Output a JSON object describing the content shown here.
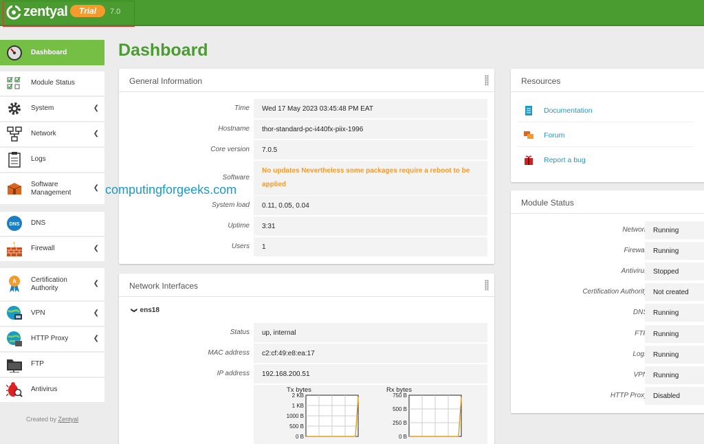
{
  "header": {
    "brand": "zentyal",
    "edition": "Trial",
    "version": "7.0"
  },
  "sidebar": {
    "items": [
      {
        "label": "Dashboard",
        "icon": "dashboard-gauge-icon",
        "active": true,
        "submenu": false
      },
      {
        "label": "Module Status",
        "icon": "checklist-icon",
        "submenu": false
      },
      {
        "label": "System",
        "icon": "gear-icon",
        "submenu": true
      },
      {
        "label": "Network",
        "icon": "network-icon",
        "submenu": true
      },
      {
        "label": "Logs",
        "icon": "clipboard-icon",
        "submenu": false
      },
      {
        "label": "Software\nManagement",
        "icon": "package-icon",
        "submenu": true
      },
      {
        "label": "DNS",
        "icon": "dns-icon",
        "submenu": false
      },
      {
        "label": "Firewall",
        "icon": "firewall-icon",
        "submenu": true
      },
      {
        "label": "Certification\nAuthority",
        "icon": "certificate-icon",
        "submenu": true
      },
      {
        "label": "VPN",
        "icon": "vpn-icon",
        "submenu": true
      },
      {
        "label": "HTTP Proxy",
        "icon": "globe-icon",
        "submenu": true
      },
      {
        "label": "FTP",
        "icon": "folder-icon",
        "submenu": false
      },
      {
        "label": "Antivirus",
        "icon": "bug-icon",
        "submenu": false
      }
    ],
    "created_by_prefix": "Created by ",
    "created_by_link": "Zentyal"
  },
  "page_title": "Dashboard",
  "watermark": "computingforgeeks.com",
  "general_info": {
    "title": "General Information",
    "rows": [
      {
        "label": "Time",
        "value": "Wed 17 May 2023 03:45:48 PM EAT"
      },
      {
        "label": "Hostname",
        "value": "thor-standard-pc-i440fx-piix-1996"
      },
      {
        "label": "Core version",
        "value": "7.0.5"
      },
      {
        "label": "Software",
        "value": "No updates Nevertheless some packages require a reboot to be applied"
      },
      {
        "label": "System load",
        "value": "0.11, 0.05, 0.04"
      },
      {
        "label": "Uptime",
        "value": "3:31"
      },
      {
        "label": "Users",
        "value": "1"
      }
    ]
  },
  "network_interfaces": {
    "title": "Network Interfaces",
    "interface": "ens18",
    "rows": [
      {
        "label": "Status",
        "value": "up, internal"
      },
      {
        "label": "MAC address",
        "value": "c2:cf:49:e8:ea:17"
      },
      {
        "label": "IP address",
        "value": "192.168.200.51"
      }
    ]
  },
  "chart_data": [
    {
      "type": "line",
      "title": "Tx bytes",
      "y_ticks": [
        "2 KB",
        "1 KB",
        "1000 B",
        "500 B",
        "0 B"
      ],
      "values": [
        0,
        0,
        0,
        0,
        0,
        0,
        0,
        0,
        0,
        0,
        0,
        0,
        0,
        0,
        0,
        0,
        0,
        0,
        0,
        1.8
      ],
      "color": "#e0a020"
    },
    {
      "type": "line",
      "title": "Rx bytes",
      "y_ticks": [
        "750 B",
        "500 B",
        "250 B",
        "0 B"
      ],
      "values": [
        0,
        0,
        0,
        0,
        0,
        0,
        0,
        0,
        0,
        0,
        0,
        0,
        0,
        0,
        0,
        0,
        0,
        0,
        0,
        700
      ],
      "color": "#e0a020"
    }
  ],
  "resources": {
    "title": "Resources",
    "links": [
      {
        "label": "Documentation",
        "icon": "document-icon"
      },
      {
        "label": "Forum",
        "icon": "chat-bubbles-icon"
      },
      {
        "label": "Report a bug",
        "icon": "gift-bug-icon"
      }
    ]
  },
  "module_status": {
    "title": "Module Status",
    "rows": [
      {
        "label": "Network",
        "value": "Running"
      },
      {
        "label": "Firewall",
        "value": "Running"
      },
      {
        "label": "Antivirus",
        "value": "Stopped"
      },
      {
        "label": "Certification Authority",
        "value": "Not created"
      },
      {
        "label": "DNS",
        "value": "Running"
      },
      {
        "label": "FTP",
        "value": "Running"
      },
      {
        "label": "Logs",
        "value": "Running"
      },
      {
        "label": "VPN",
        "value": "Running"
      },
      {
        "label": "HTTP Proxy",
        "value": "Disabled"
      }
    ]
  },
  "colors": {
    "brand_green": "#4a9c30",
    "active_green": "#74bf44",
    "accent_orange": "#f39b2d",
    "link_blue": "#1b9ac6"
  }
}
